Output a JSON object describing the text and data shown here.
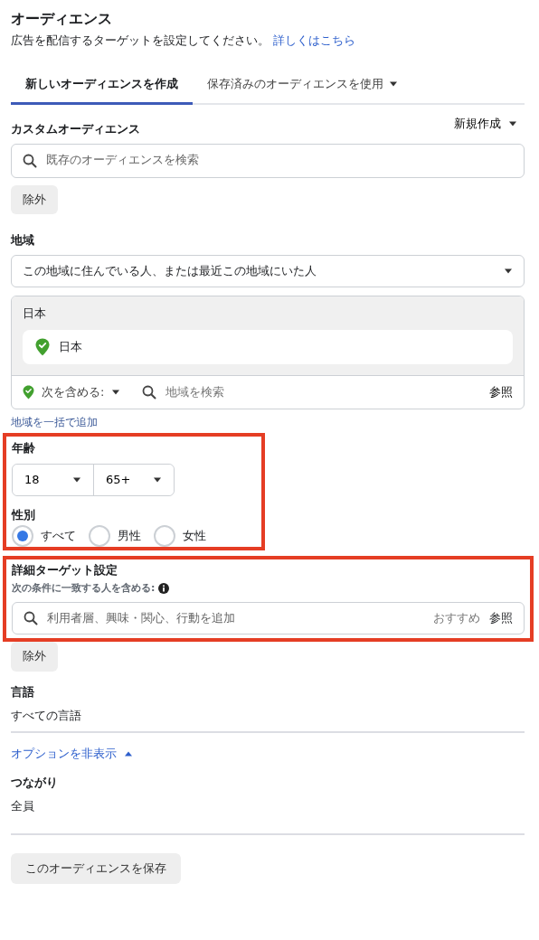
{
  "header": {
    "title": "オーディエンス",
    "description": "広告を配信するターゲットを設定してください。",
    "learn_more": "詳しくはこちら"
  },
  "tabs": [
    {
      "label": "新しいオーディエンスを作成",
      "selected": true,
      "dropdown": false
    },
    {
      "label": "保存済みのオーディエンスを使用",
      "selected": false,
      "dropdown": true
    }
  ],
  "custom_audience": {
    "label": "カスタムオーディエンス",
    "create_new": "新規作成",
    "search_placeholder": "既存のオーディエンスを検索",
    "exclude": "除外"
  },
  "location": {
    "label": "地域",
    "mode": "この地域に住んでいる人、または最近この地域にいた人",
    "group_label": "日本",
    "items": [
      {
        "name": "日本"
      }
    ],
    "include_label": "次を含める:",
    "search_placeholder": "地域を検索",
    "browse": "参照",
    "bulk_add": "地域を一括で追加"
  },
  "age_gender": {
    "highlighted": true,
    "age_label": "年齢",
    "age_min": "18",
    "age_max": "65+",
    "gender_label": "性別",
    "genders": [
      {
        "label": "すべて",
        "selected": true
      },
      {
        "label": "男性",
        "selected": false
      },
      {
        "label": "女性",
        "selected": false
      }
    ]
  },
  "detailed_targeting": {
    "highlighted": true,
    "label": "詳細ターゲット設定",
    "sublabel": "次の条件に一致する人を含める:",
    "search_placeholder": "利用者層、興味・関心、行動を追加",
    "suggestions": "おすすめ",
    "browse": "参照",
    "exclude": "除外"
  },
  "language": {
    "label": "言語",
    "value": "すべての言語"
  },
  "hide_options": "オプションを非表示",
  "connections": {
    "label": "つながり",
    "value": "全員"
  },
  "save_button": "このオーディエンスを保存"
}
